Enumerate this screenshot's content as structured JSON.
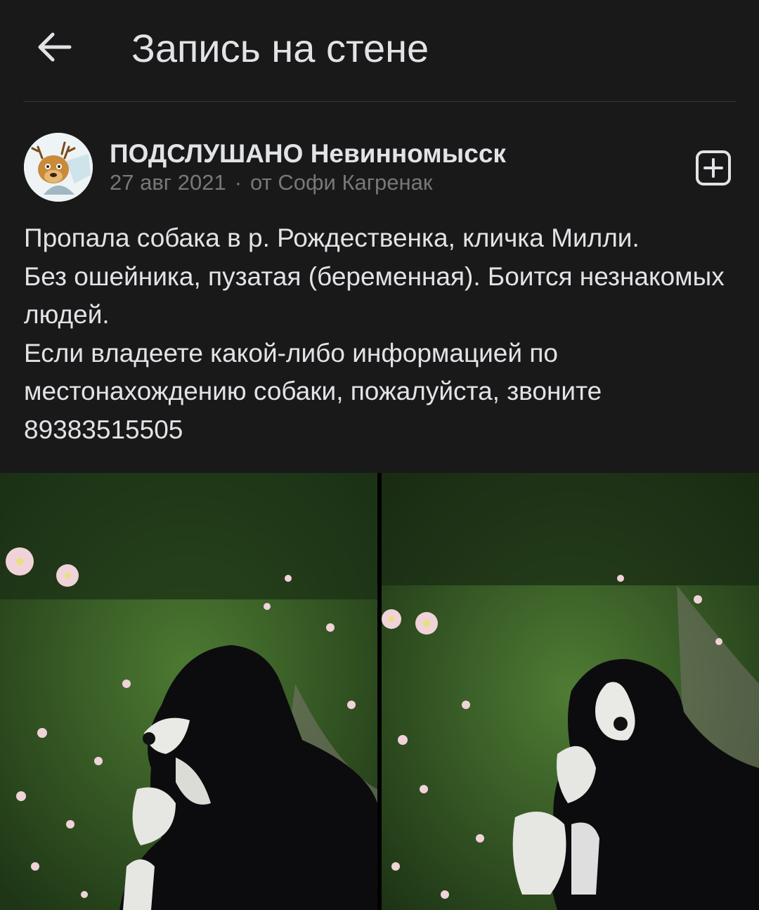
{
  "header": {
    "title": "Запись на стене",
    "back_icon": "arrow-left-icon"
  },
  "post": {
    "group_name": "ПОДСЛУШАНО Невинномысск",
    "date": "27 авг 2021",
    "separator": "·",
    "author": "от Софи Кагренак",
    "subscribe_icon": "plus-square-icon",
    "text_lines": [
      "Пропала собака в р. Рождественка, кличка Милли.",
      "Без ошейника, пузатая (беременная). Боится незнакомых людей.",
      "Если владеете какой-либо информацией по местонахождению собаки, пожалуйста, звоните 89383515505"
    ]
  },
  "photos": [
    {
      "name": "dog-photo-1",
      "subject": "dog lying on grass"
    },
    {
      "name": "dog-photo-2",
      "subject": "dog lying on grass"
    }
  ],
  "colors": {
    "background": "#19191a",
    "text_primary": "#e1e3e6",
    "text_secondary": "#76787a",
    "divider": "#363738"
  }
}
